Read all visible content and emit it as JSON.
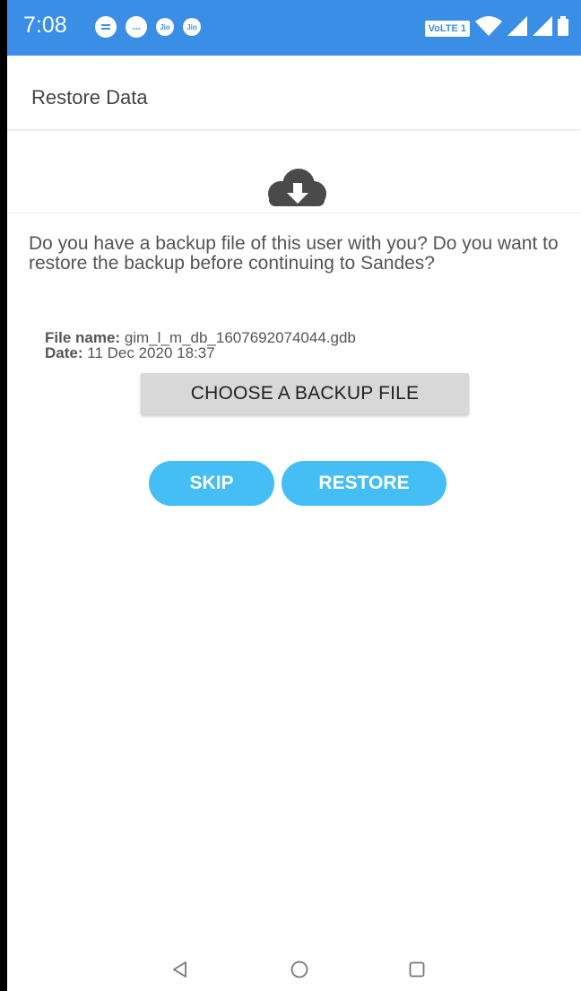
{
  "status_bar": {
    "time": "7:08",
    "left_icons": [
      "chat-bubble-icon",
      "message-icon",
      "jio-icon",
      "jio-icon"
    ],
    "left_icon_labels": [
      "",
      "...",
      "Jio",
      "Jio"
    ],
    "volte": "VoLTE 1",
    "right_icons": [
      "volte-badge",
      "wifi-icon",
      "signal-icon",
      "signal-icon",
      "battery-icon"
    ]
  },
  "app_bar": {
    "title": "Restore Data"
  },
  "main": {
    "cloud_icon": "cloud-download-icon",
    "question": "Do you have a backup file of this user with you? Do you want to restore the backup before continuing to Sandes?",
    "file_name_label": "File name:",
    "file_name_value": "gim_l_m_db_1607692074044.gdb",
    "date_label": "Date:",
    "date_value": "11 Dec 2020 18:37",
    "choose_button": "CHOOSE A BACKUP FILE",
    "skip_button": "SKIP",
    "restore_button": "RESTORE"
  },
  "nav_bar": {
    "icons": [
      "back-icon",
      "home-icon",
      "recents-icon"
    ]
  },
  "colors": {
    "status_bar": "#3a8ee6",
    "accent_button": "#45bdf5",
    "neutral_button": "#d8d8d8",
    "cloud": "#4a4a4a"
  }
}
